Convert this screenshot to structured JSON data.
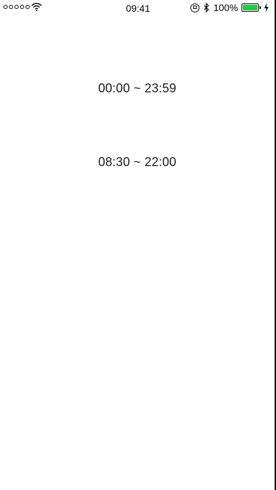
{
  "status_bar": {
    "signal_icon": "signal-dots-icon",
    "wifi_icon": "wifi-icon",
    "time": "09:41",
    "rotation_lock_icon": "rotation-lock-icon",
    "bluetooth_icon": "bluetooth-icon",
    "battery_percent": "100%",
    "battery_level": 1.0,
    "battery_color": "#22c84a",
    "charging_icon": "charging-bolt-icon"
  },
  "ranges": [
    {
      "label": "00:00 ~ 23:59"
    },
    {
      "label": "08:30 ~ 22:00"
    }
  ]
}
